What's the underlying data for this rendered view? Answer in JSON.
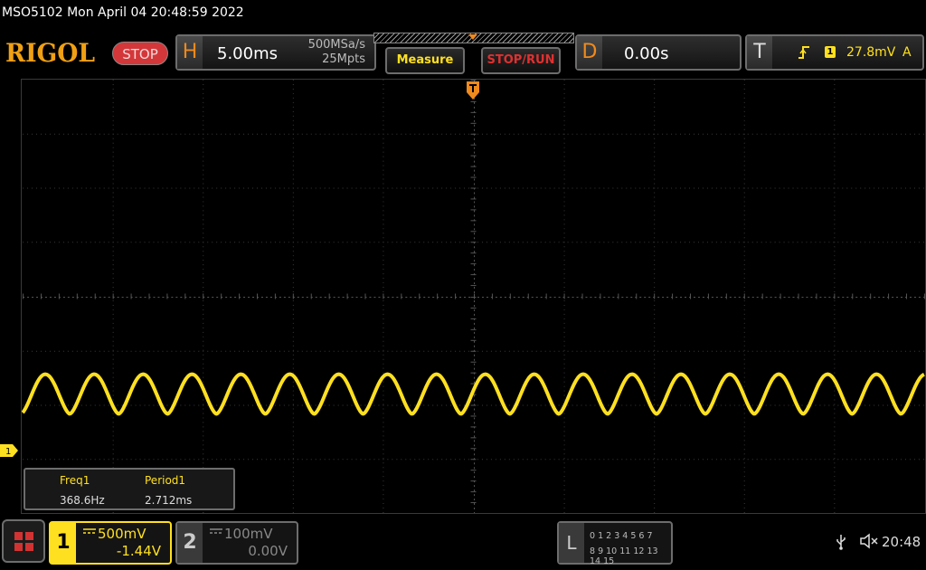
{
  "title_bar": {
    "text": "MSO5102  Mon April 04 20:48:59 2022"
  },
  "brand": {
    "logo": "RIGOL",
    "run_state": "STOP"
  },
  "horizontal": {
    "tag": "H",
    "timebase": "5.00ms",
    "sample_rate": "500MSa/s",
    "memory_depth": "25Mpts"
  },
  "buttons": {
    "measure": "Measure",
    "stop_run": "STOP/RUN"
  },
  "delay": {
    "tag": "D",
    "value": "0.00s"
  },
  "trigger": {
    "tag": "T",
    "source": "1",
    "level": "27.8mV",
    "mode": "A",
    "icon": "rising-edge-icon"
  },
  "measurements": [
    {
      "name": "Freq1",
      "value": "368.6Hz"
    },
    {
      "name": "Period1",
      "value": "2.712ms"
    }
  ],
  "channels": [
    {
      "num": "1",
      "coupling": "DC",
      "scale": "500mV",
      "offset": "-1.44V",
      "active": true,
      "color": "#ffe020"
    },
    {
      "num": "2",
      "coupling": "DC",
      "scale": "100mV",
      "offset": "0.00V",
      "active": false,
      "color": "#888888"
    }
  ],
  "ch1_marker": "1",
  "logic": {
    "tag": "L",
    "row1": "0 1 2 3   4 5 6 7",
    "row2": "8 9 10 11 12 13 14 15"
  },
  "status": {
    "time": "20:48",
    "usb_icon": "usb-icon",
    "speaker_icon": "speaker-muted-icon"
  },
  "waveform": {
    "frequency_hz": 368.6,
    "period_ms": 2.712,
    "color": "#ffe020"
  }
}
